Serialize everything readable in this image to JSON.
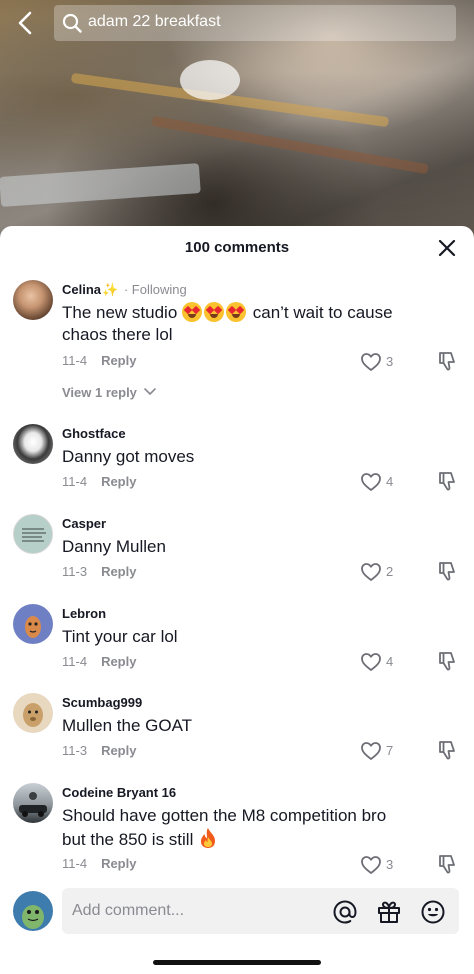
{
  "search": {
    "query": "adam 22 breakfast"
  },
  "comments_header": {
    "title": "100 comments"
  },
  "comments": [
    {
      "username": "Celina",
      "following": "· Following",
      "text_before_emoji": "The new studio ",
      "text_after_emoji": " can’t wait to cause chaos there lol",
      "date": "11-4",
      "reply": "Reply",
      "likes": "3",
      "view_replies": "View 1 reply"
    },
    {
      "username": "Ghostface",
      "text": "Danny got moves",
      "date": "11-4",
      "reply": "Reply",
      "likes": "4"
    },
    {
      "username": "Casper",
      "text": "Danny Mullen",
      "date": "11-3",
      "reply": "Reply",
      "likes": "2"
    },
    {
      "username": "Lebron",
      "text": "Tint your car lol",
      "date": "11-4",
      "reply": "Reply",
      "likes": "4"
    },
    {
      "username": "Scumbag999",
      "text": "Mullen the GOAT",
      "date": "11-3",
      "reply": "Reply",
      "likes": "7"
    },
    {
      "username": "Codeine Bryant 16",
      "text": "Should have gotten the M8 competition bro but the 850 is still",
      "date": "11-4",
      "reply": "Reply",
      "likes": "3"
    }
  ],
  "input": {
    "placeholder": "Add comment..."
  },
  "icons": {
    "back": "chevron-left-icon",
    "search": "search-icon",
    "close": "close-icon",
    "like": "heart-outline-icon",
    "dislike": "thumbs-down-icon",
    "mention": "at-sign-icon",
    "gift": "gift-icon",
    "emoji": "smiley-icon"
  },
  "colors": {
    "text_primary": "#161823",
    "text_secondary": "#8a8b91",
    "input_bg": "#f1f1f2"
  }
}
